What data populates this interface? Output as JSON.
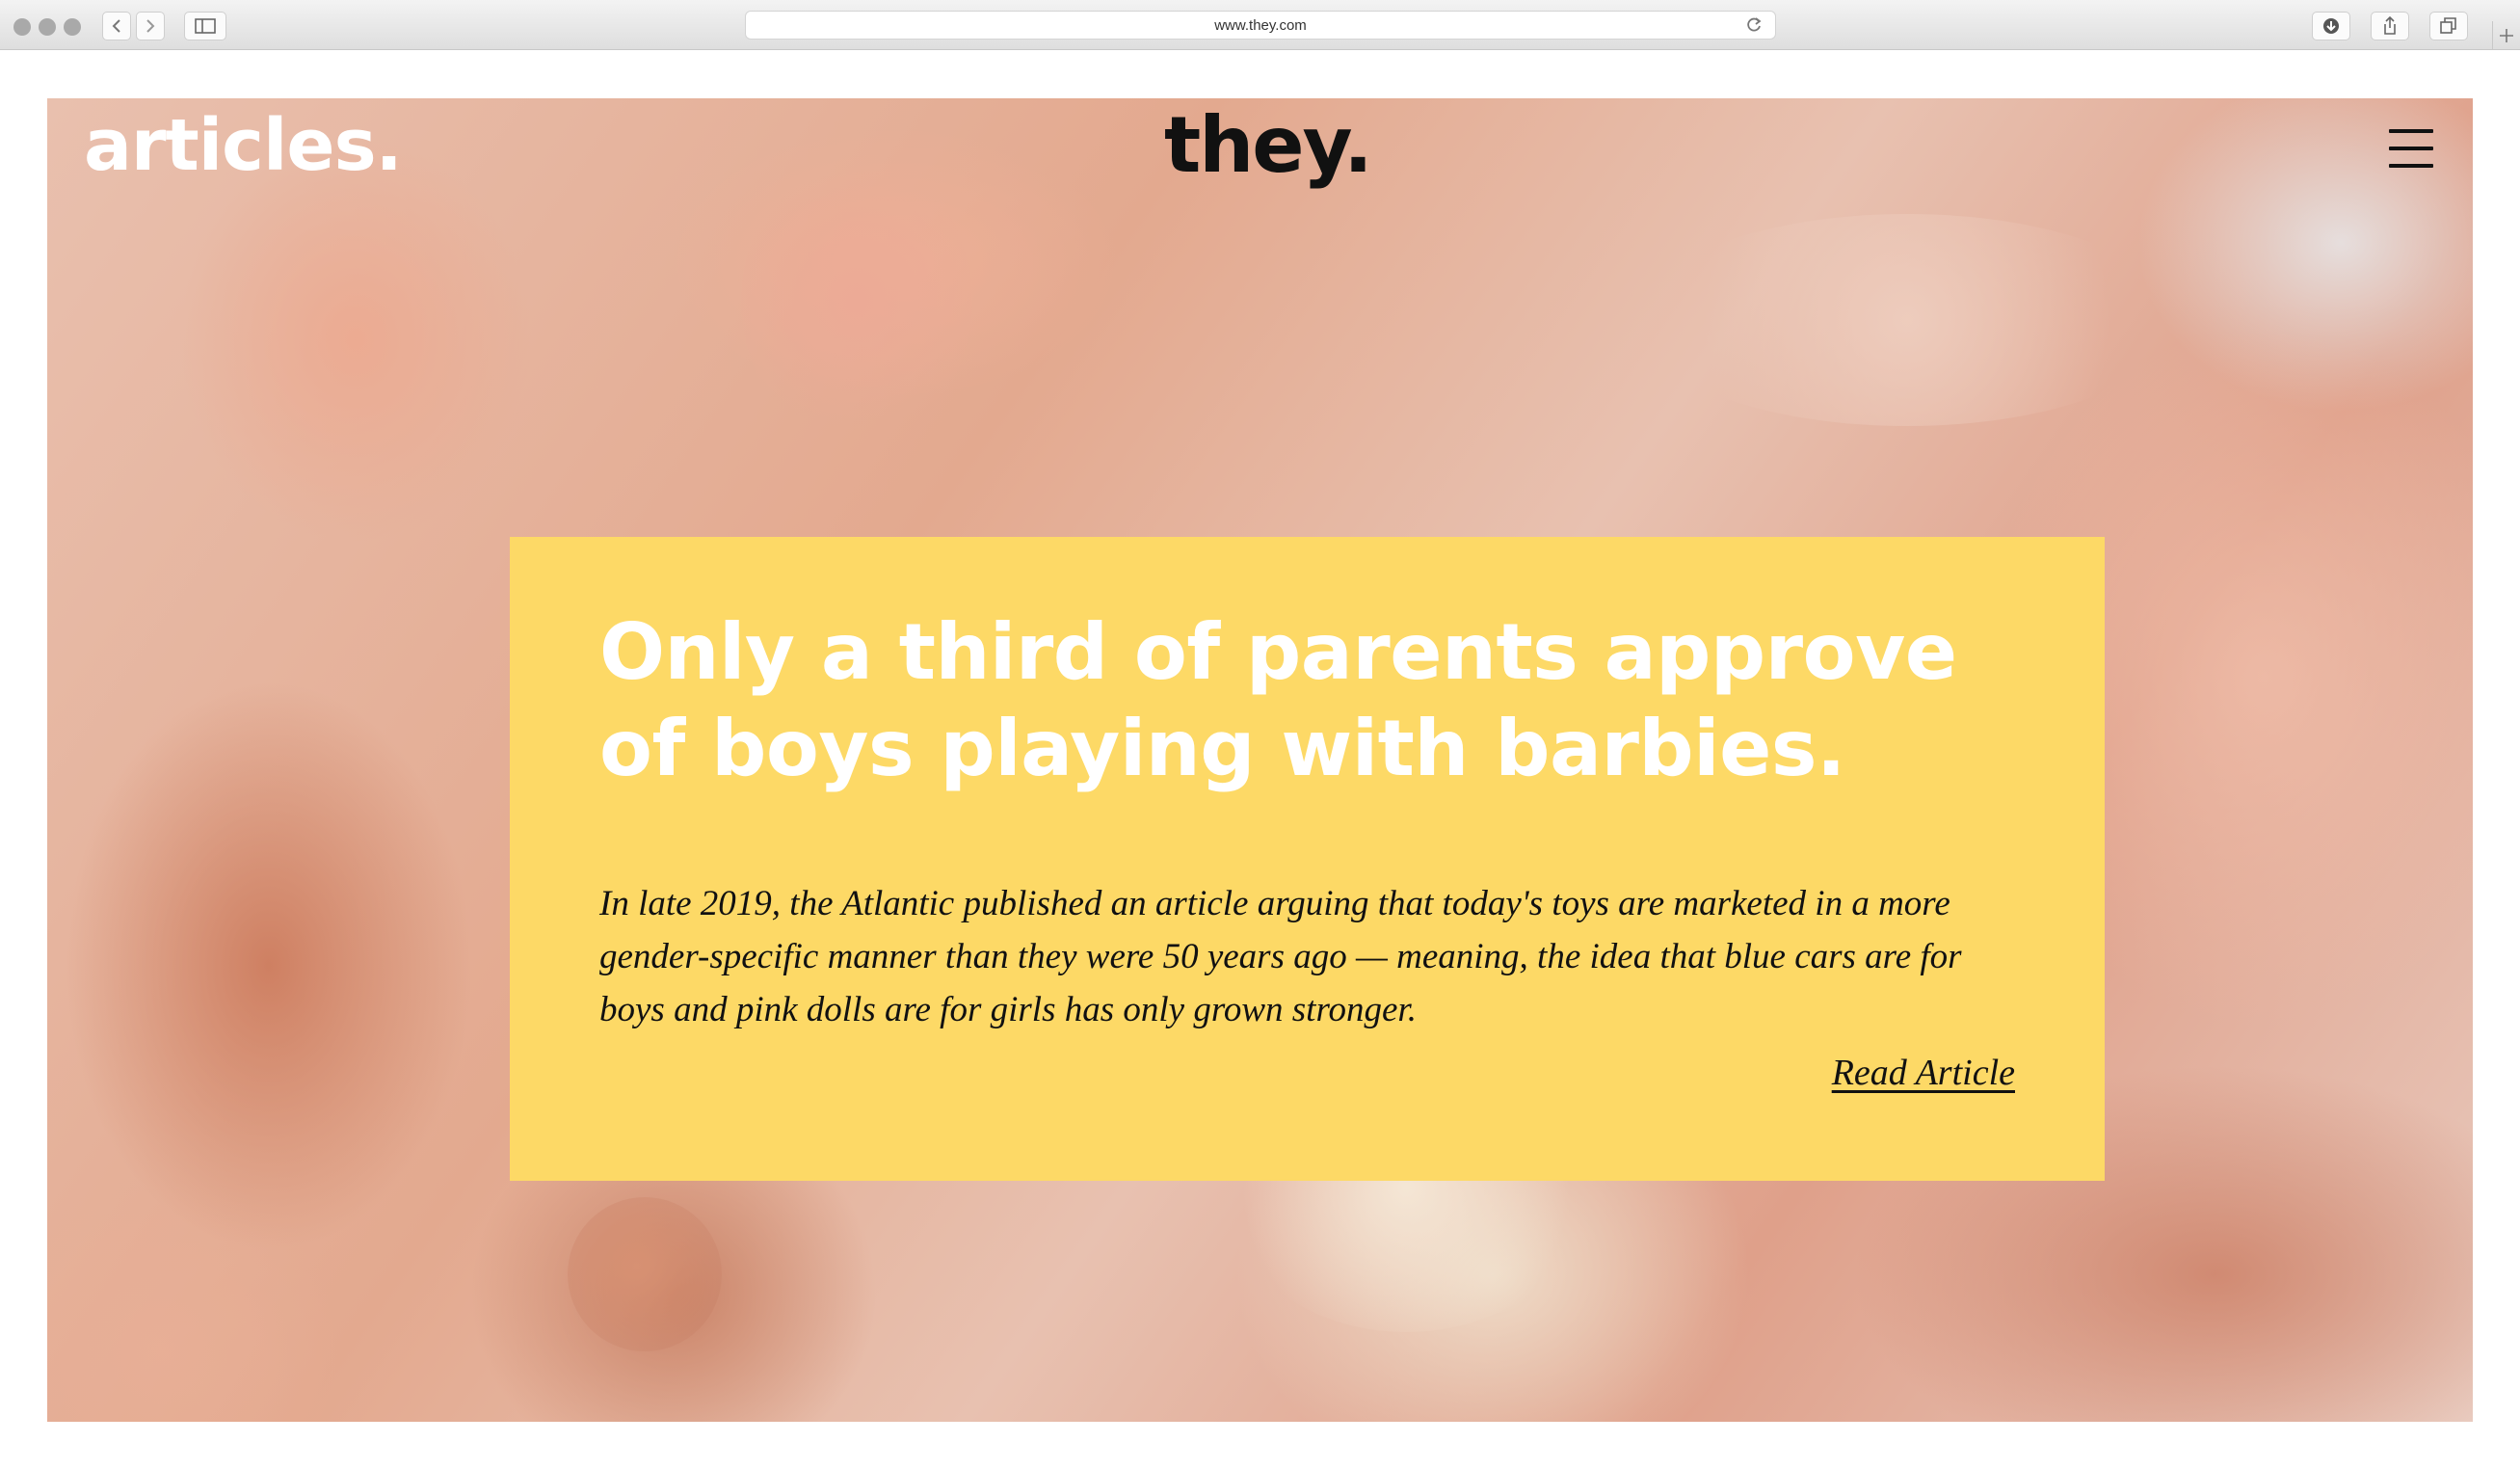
{
  "browser": {
    "url": "www.they.com",
    "icons": {
      "close": "close-dot-icon",
      "minimize": "minimize-dot-icon",
      "maximize": "maximize-dot-icon",
      "back": "chevron-left-icon",
      "forward": "chevron-right-icon",
      "sidebar": "sidebar-icon",
      "reload": "reload-icon",
      "downloads": "download-icon",
      "share": "share-icon",
      "tabs": "tabs-icon",
      "new_tab": "plus-icon"
    }
  },
  "header": {
    "section_logo": "articles.",
    "brand_logo": "they.",
    "menu_icon": "hamburger-menu-icon"
  },
  "article": {
    "headline": "Only a third of parents approve of boys playing with barbies.",
    "excerpt": "In late 2019, the Atlantic published an article arguing that today's toys are marketed in a more gender-specific manner than they were 50 years ago — meaning, the idea that blue cars are for boys and pink dolls are for girls has only grown stronger.",
    "link_label": "Read Article"
  },
  "colors": {
    "card_background": "#fdd966",
    "headline": "#ffffff",
    "body_text": "#111111",
    "section_logo": "#ffffff",
    "brand_logo": "#111111"
  }
}
